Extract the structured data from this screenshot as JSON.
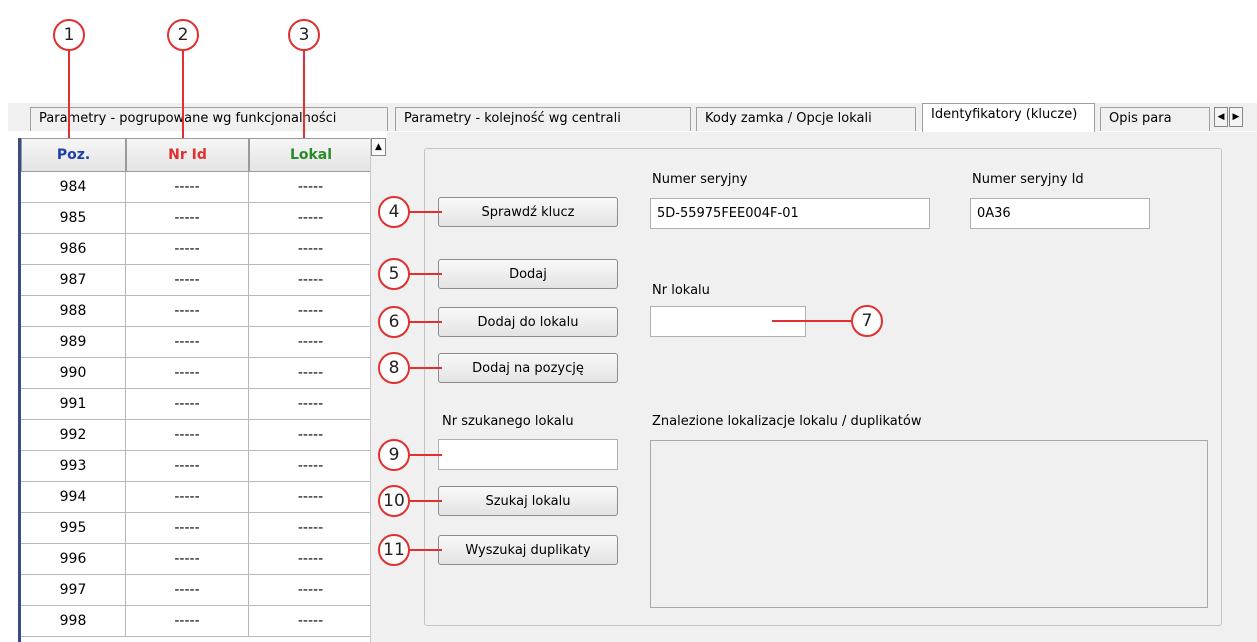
{
  "callouts": [
    "1",
    "2",
    "3",
    "4",
    "5",
    "6",
    "7",
    "8",
    "9",
    "10",
    "11"
  ],
  "tabs": [
    {
      "label": "Parametry - pogrupowane wg funkcjonalności"
    },
    {
      "label": "Parametry - kolejność wg centrali"
    },
    {
      "label": "Kody zamka / Opcje lokali"
    },
    {
      "label": "Identyfikatory (klucze)"
    },
    {
      "label": "Opis para"
    }
  ],
  "grid": {
    "headers": [
      {
        "label": "Poz.",
        "color": "#1f3fa8"
      },
      {
        "label": "Nr Id",
        "color": "#e03030"
      },
      {
        "label": "Lokal",
        "color": "#2a8a2a"
      }
    ],
    "rows": [
      {
        "poz": "984",
        "nr_id": "-----",
        "lokal": "-----"
      },
      {
        "poz": "985",
        "nr_id": "-----",
        "lokal": "-----"
      },
      {
        "poz": "986",
        "nr_id": "-----",
        "lokal": "-----"
      },
      {
        "poz": "987",
        "nr_id": "-----",
        "lokal": "-----"
      },
      {
        "poz": "988",
        "nr_id": "-----",
        "lokal": "-----"
      },
      {
        "poz": "989",
        "nr_id": "-----",
        "lokal": "-----"
      },
      {
        "poz": "990",
        "nr_id": "-----",
        "lokal": "-----"
      },
      {
        "poz": "991",
        "nr_id": "-----",
        "lokal": "-----"
      },
      {
        "poz": "992",
        "nr_id": "-----",
        "lokal": "-----"
      },
      {
        "poz": "993",
        "nr_id": "-----",
        "lokal": "-----"
      },
      {
        "poz": "994",
        "nr_id": "-----",
        "lokal": "-----"
      },
      {
        "poz": "995",
        "nr_id": "-----",
        "lokal": "-----"
      },
      {
        "poz": "996",
        "nr_id": "-----",
        "lokal": "-----"
      },
      {
        "poz": "997",
        "nr_id": "-----",
        "lokal": "-----"
      },
      {
        "poz": "998",
        "nr_id": "-----",
        "lokal": "-----"
      }
    ]
  },
  "panel": {
    "serial_label": "Numer seryjny",
    "serial_value": "5D-55975FEE004F-01",
    "serial_id_label": "Numer seryjny Id",
    "serial_id_value": "0A36",
    "check_key_button": "Sprawdź klucz",
    "add_button": "Dodaj",
    "add_to_unit_button": "Dodaj do lokalu",
    "add_at_position_button": "Dodaj na pozycję",
    "unit_number_label": "Nr lokalu",
    "unit_number_value": "",
    "search_unit_label": "Nr szukanego lokalu",
    "search_unit_value": "",
    "search_unit_button": "Szukaj lokalu",
    "find_duplicates_button": "Wyszukaj duplikaty",
    "found_locations_label": "Znalezione lokalizacje lokalu / duplikatów"
  },
  "accent_color": "#e03030"
}
